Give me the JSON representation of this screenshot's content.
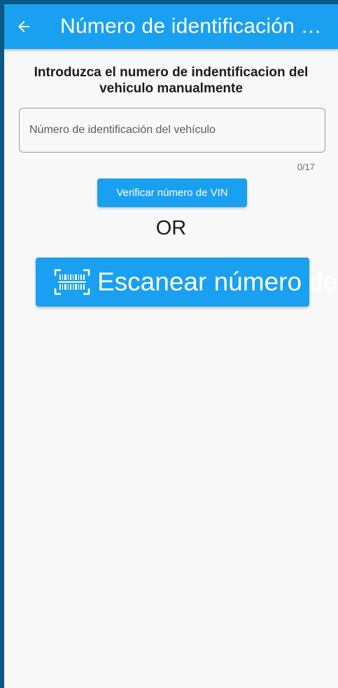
{
  "appbar": {
    "title": "Número de identificación del vehículo",
    "back_icon": "arrow-back-icon",
    "color": "#1aa0f0"
  },
  "form": {
    "heading": "Introduzca el numero de indentificacion del vehiculo manualmente",
    "vin_input": {
      "value": "",
      "placeholder": "Número de identificación del vehículo",
      "counter": "0/17"
    },
    "verify_button": "Verificar número de VIN",
    "or_label": "OR",
    "scan_button": {
      "icon": "barcode-scan-icon",
      "label": "Escanear número de VIN"
    }
  },
  "colors": {
    "accent": "#1aa0f0",
    "background": "#f8f8f8",
    "frame": "#0b5a86"
  }
}
